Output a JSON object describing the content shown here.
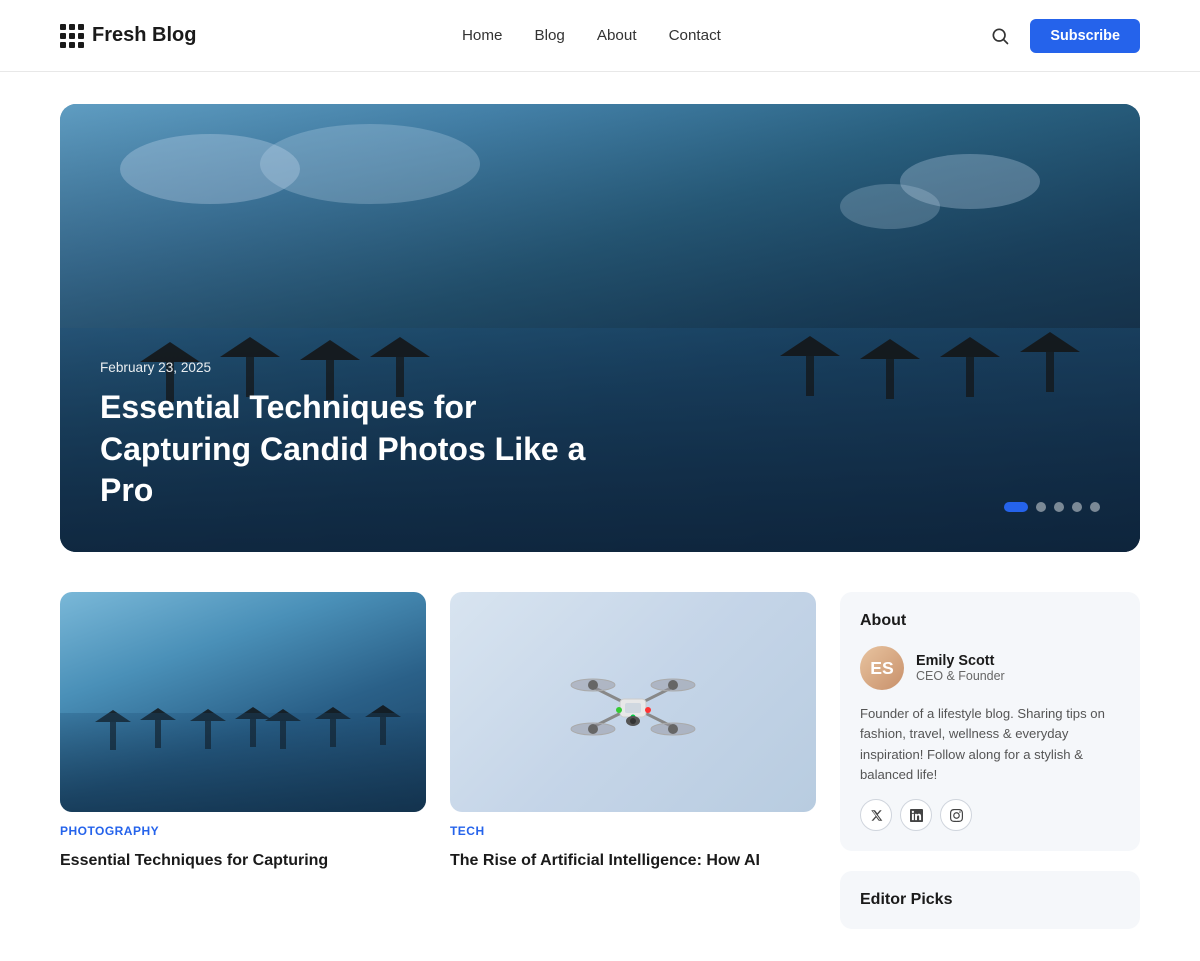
{
  "site": {
    "logo_text": "Fresh Blog",
    "logo_icon": "grid-dots-icon"
  },
  "nav": {
    "links": [
      {
        "label": "Home",
        "href": "#"
      },
      {
        "label": "Blog",
        "href": "#"
      },
      {
        "label": "About",
        "href": "#"
      },
      {
        "label": "Contact",
        "href": "#"
      }
    ],
    "subscribe_label": "Subscribe",
    "search_label": "Search"
  },
  "hero": {
    "date": "February 23, 2025",
    "title": "Essential Techniques for Capturing Candid Photos Like a Pro",
    "dots": [
      {
        "active": true
      },
      {
        "active": false
      },
      {
        "active": false
      },
      {
        "active": false
      },
      {
        "active": false
      }
    ]
  },
  "articles": [
    {
      "category": "Photography",
      "title": "Essential Techniques for Capturing",
      "image_type": "pool"
    },
    {
      "category": "Tech",
      "title": "The Rise of Artificial Intelligence: How AI",
      "image_type": "drone"
    }
  ],
  "sidebar": {
    "about": {
      "widget_title": "About",
      "author_name": "Emily Scott",
      "author_role": "CEO & Founder",
      "author_initials": "ES",
      "bio": "Founder of a lifestyle blog. Sharing tips on fashion, travel, wellness & everyday inspiration! Follow along for a stylish & balanced life!",
      "social": [
        {
          "icon": "x-twitter-icon",
          "label": "X / Twitter"
        },
        {
          "icon": "linkedin-icon",
          "label": "LinkedIn"
        },
        {
          "icon": "instagram-icon",
          "label": "Instagram"
        }
      ]
    },
    "editor_picks": {
      "widget_title": "Editor Picks"
    }
  }
}
